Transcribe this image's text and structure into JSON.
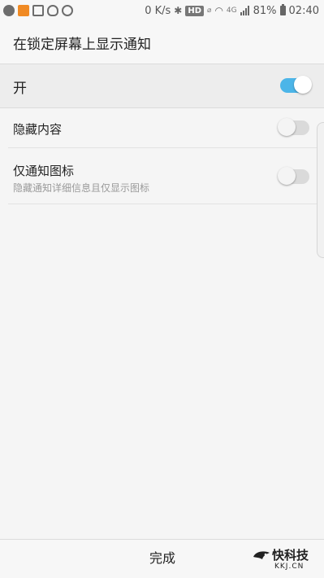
{
  "status_bar": {
    "speed": "0 K/s",
    "hd": "HD",
    "network": "4G",
    "battery": "81%",
    "time": "02:40"
  },
  "header": {
    "title": "在锁定屏幕上显示通知"
  },
  "master": {
    "label": "开",
    "on": true
  },
  "options": [
    {
      "title": "隐藏内容",
      "subtitle": "",
      "on": false
    },
    {
      "title": "仅通知图标",
      "subtitle": "隐藏通知详细信息且仅显示图标",
      "on": false
    }
  ],
  "bottom": {
    "done_label": "完成"
  },
  "watermark": {
    "brand": "快科技",
    "domain": "KKJ.CN"
  },
  "colors": {
    "accent": "#4cb5e8",
    "switch_off": "#dadada"
  }
}
